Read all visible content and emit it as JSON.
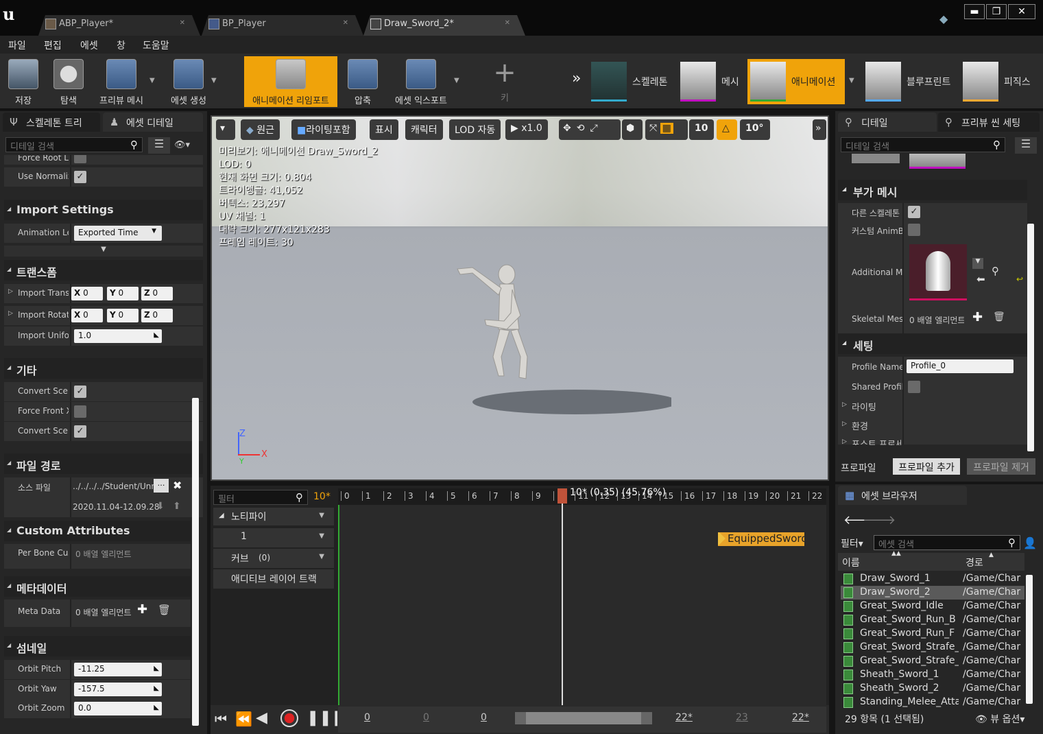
{
  "tabs": [
    {
      "label": "ABP_Player*"
    },
    {
      "label": "BP_Player"
    },
    {
      "label": "Draw_Sword_2*"
    }
  ],
  "menu": [
    "파일",
    "편집",
    "에셋",
    "창",
    "도움말"
  ],
  "toolbar": {
    "save": "저장",
    "browse": "탐색",
    "preview_mesh": "프리뷰 메시",
    "create_asset": "에셋 생성",
    "reimport": "애니메이션 리임포트",
    "compress": "압축",
    "export": "에셋 익스포트",
    "key": "키"
  },
  "modes": {
    "skeleton": "스켈레톤",
    "mesh": "메시",
    "animation": "애니메이션",
    "blueprint": "블루프린트",
    "physics": "피직스"
  },
  "left": {
    "tab_skeleton": "스켈레톤 트리",
    "tab_asset_details": "에셋 디테일",
    "search_placeholder": "디테일 검색",
    "rows_top": [
      {
        "label": "Force Root Lock"
      },
      {
        "label": "Use Normalized Root Motion Scale"
      }
    ],
    "import_settings": "Import Settings",
    "animation_length_label": "Animation Length",
    "animation_length_value": "Exported Time",
    "transform": "트랜스폼",
    "import_translation": "Import Translation",
    "import_rotation": "Import Rotation",
    "x": "X",
    "y": "Y",
    "z": "Z",
    "zero": "0",
    "import_uniform": "Import Uniform Scale",
    "import_uniform_value": "1.0",
    "misc": "기타",
    "convert_scene": "Convert Scene",
    "force_front": "Force Front XAxis",
    "convert_scene_unit": "Convert Scene Unit",
    "file_path": "파일 경로",
    "source_file": "소스 파일",
    "source_value": "../../../../Student/Unreal",
    "timestamp": "2020.11.04-12.09.28",
    "custom_attributes": "Custom Attributes",
    "per_bone": "Per Bone Custom Attribute",
    "per_bone_value": "0 배열 엘리먼트",
    "metadata": "메타데이터",
    "meta_data": "Meta Data",
    "meta_value": "0 배열 엘리먼트",
    "thumbnail": "섬네일",
    "orbit_pitch": "Orbit Pitch",
    "orbit_pitch_v": "-11.25",
    "orbit_yaw": "Orbit Yaw",
    "orbit_yaw_v": "-157.5",
    "orbit_zoom": "Orbit Zoom",
    "orbit_zoom_v": "0.0"
  },
  "viewport": {
    "btn_perspective": "원근",
    "btn_lighting": "라이팅포함",
    "btn_show": "표시",
    "btn_character": "캐릭터",
    "btn_lod": "LOD 자동",
    "btn_speed": "x1.0",
    "grid_value": "10",
    "angle_value": "10°",
    "overlay": [
      "미리보기: 애니메이션 Draw_Sword_2",
      "LOD: 0",
      "현재 화면 크기: 0.804",
      "트라이앵글: 41,052",
      "버텍스: 23,297",
      "UV 채널: 1",
      "대략 크기: 277x121x283",
      "프레임 레이트: 30"
    ]
  },
  "timeline": {
    "filter_placeholder": "필터",
    "frame": "10*",
    "notifies": "노티파이",
    "notify_track": "1",
    "curves": "커브",
    "curves_count": "(0)",
    "additive": "애디티브 레이어 트랙",
    "scrub_label": "10* (0.35) (45.76%)",
    "ticks": [
      "0",
      "1",
      "2",
      "3",
      "4",
      "5",
      "6",
      "7",
      "8",
      "9",
      "10",
      "11",
      "12",
      "13",
      "14",
      "15",
      "16",
      "17",
      "18",
      "19",
      "20",
      "21",
      "22"
    ],
    "notify_name": "EquippedSword",
    "bottom": [
      "0",
      "0",
      "0",
      "22*",
      "23",
      "22*"
    ]
  },
  "right": {
    "tab_details": "디테일",
    "tab_preview": "프리뷰 씬 세팅",
    "search_placeholder": "디테일 검색",
    "add_mesh": "부가 메시",
    "other_skeleton": "다른 스켈레톤",
    "custom_anim": "커스텀 AnimBP",
    "additional": "Additional Meshes",
    "skeletal_mesh": "Skeletal Meshes",
    "skeletal_value": "0 배열 엘리먼트",
    "settings": "세팅",
    "profile_name": "Profile Name",
    "profile_value": "Profile_0",
    "shared_profile": "Shared Profile",
    "lighting": "라이팅",
    "environment": "환경",
    "post_process": "포스트 프로세스",
    "profile": "프로파일",
    "profile_add": "프로파일 추가",
    "profile_remove": "프로파일 제거",
    "asset_browser": "에셋 브라우저",
    "filter": "필터",
    "asset_search": "에셋 검색",
    "col_name": "이름",
    "col_path": "경로",
    "assets": [
      {
        "name": "Draw_Sword_1",
        "path": "/Game/Char"
      },
      {
        "name": "Draw_Sword_2",
        "path": "/Game/Char"
      },
      {
        "name": "Great_Sword_Idle",
        "path": "/Game/Char"
      },
      {
        "name": "Great_Sword_Run_B",
        "path": "/Game/Char"
      },
      {
        "name": "Great_Sword_Run_F",
        "path": "/Game/Char"
      },
      {
        "name": "Great_Sword_Strafe_L",
        "path": "/Game/Char"
      },
      {
        "name": "Great_Sword_Strafe_R",
        "path": "/Game/Char"
      },
      {
        "name": "Sheath_Sword_1",
        "path": "/Game/Char"
      },
      {
        "name": "Sheath_Sword_2",
        "path": "/Game/Char"
      },
      {
        "name": "Standing_Melee_Attack",
        "path": "/Game/Char"
      }
    ],
    "count": "29 항목 (1 선택됨)",
    "view_options": "뷰 옵션"
  }
}
